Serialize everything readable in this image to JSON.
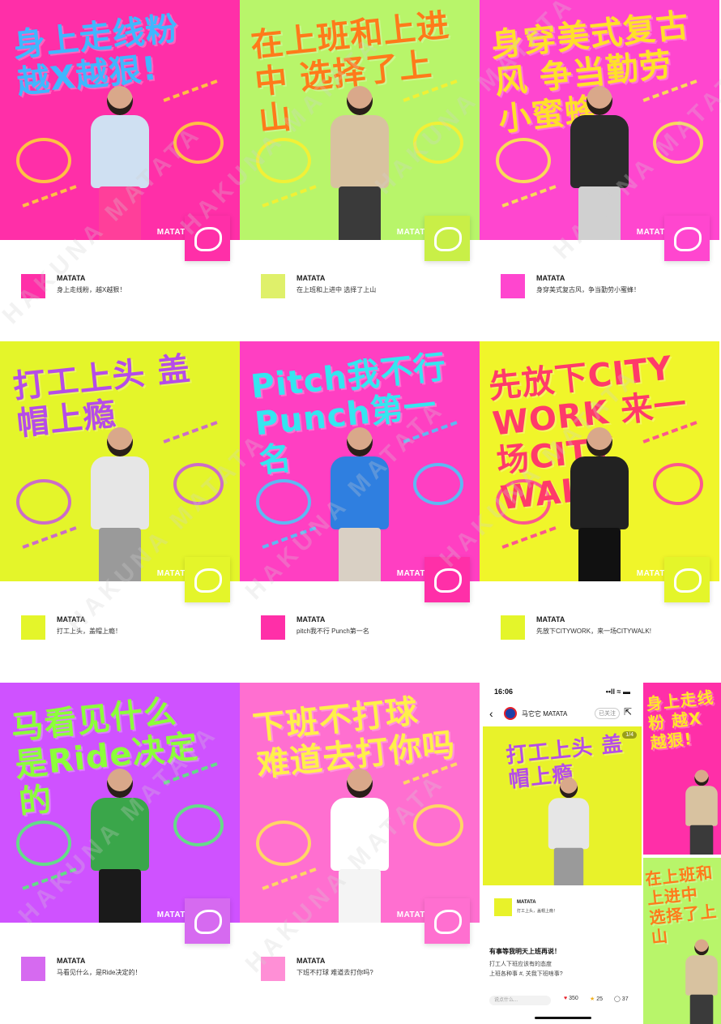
{
  "brand": "MATATA",
  "watermark": "HAKUNA MATATA",
  "posts": [
    {
      "headline": "身上走线粉 越X越狠!",
      "caption": "身上走线粉，越X越狠！",
      "bg": "#ff2fa8",
      "text_color": "#3fb7ff",
      "doodle_color": "#ffe52a",
      "sticker": "#ff2fa8",
      "avatar": "#ff2fa8",
      "top_color": "#cfe0f2",
      "bottom_color": "#ff3f9a"
    },
    {
      "headline": "在上班和上进中 选择了上山",
      "caption": "在上班和上进中 选择了上山",
      "bg": "#b8f56a",
      "text_color": "#ff7a1a",
      "doodle_color": "#ffef2a",
      "sticker": "#c9ef47",
      "avatar": "#dff06a",
      "top_color": "#d8c2a0",
      "bottom_color": "#3a3a3a"
    },
    {
      "headline": "身穿美式复古风 争当勤劳小蜜蜂",
      "caption": "身穿美式复古风，争当勤劳小蜜蜂！",
      "bg": "#ff46cf",
      "text_color": "#ffe02a",
      "doodle_color": "#f7ff3a",
      "sticker": "#ff46cf",
      "avatar": "#ff46cf",
      "top_color": "#2b2b2b",
      "bottom_color": "#d0d0d0"
    },
    {
      "headline": "打工上头 盖帽上瘾",
      "caption": "打工上头，盖帽上瘾！",
      "bg": "#e4f52a",
      "text_color": "#b54ce8",
      "doodle_color": "#c54af0",
      "sticker": "#e4f52a",
      "avatar": "#e4f52a",
      "top_color": "#e6e6e6",
      "bottom_color": "#9a9a9a"
    },
    {
      "headline": "Pitch我不行 Punch第一名",
      "caption": "pitch我不行 Punch第一名",
      "bg": "#ff3fc2",
      "text_color": "#34e6f0",
      "doodle_color": "#35d8ff",
      "sticker": "#ff2fa8",
      "avatar": "#ff2fa8",
      "top_color": "#2f7fe0",
      "bottom_color": "#d9d0c4"
    },
    {
      "headline": "先放下CITY WORK 来一场CITY WALK",
      "caption": "先放下CITYWORK，来一场CITYWALK!",
      "bg": "#f0f52a",
      "text_color": "#ff3a6a",
      "doodle_color": "#ff2fa8",
      "sticker": "#e4f52a",
      "avatar": "#e4f52a",
      "top_color": "#222222",
      "bottom_color": "#111111"
    },
    {
      "headline": "马看见什么 是Ride决定的",
      "caption": "马看见什么，是Ride决定的！",
      "bg": "#cf52ff",
      "text_color": "#8cff3a",
      "doodle_color": "#4aff6a",
      "sticker": "#d66af0",
      "avatar": "#d66af0",
      "top_color": "#3aa64a",
      "bottom_color": "#1a1a1a"
    },
    {
      "headline": "下班不打球 难道去打你吗",
      "caption": "下班不打球 难道去打你吗?",
      "bg": "#ff6fd0",
      "text_color": "#fff04a",
      "doodle_color": "#fff04a",
      "sticker": "#ff6fd0",
      "avatar": "#ff8fd6",
      "top_color": "#ffffff",
      "bottom_color": "#f4f4f4"
    }
  ],
  "phone": {
    "time": "16:06",
    "status_icons": "••ll ≈ ▬",
    "account": "马它它 MATATA",
    "follow": "已关注",
    "page_badge": "1/4",
    "post_headline": "打工上头 盖帽上瘾",
    "meta_name": "MATATA",
    "meta_caption": "打工上头，盖帽上瘾！",
    "title": "有事等我明天上班再说！",
    "body_line1": "打工人下班应该有的态度",
    "body_line2": "上班各种事 #, 关我下班啥事?",
    "comment_placeholder": "说点什么...",
    "likes": "350",
    "stars": "25",
    "comments": "37",
    "like_color": "#e8212b",
    "star_color": "#f2b01e"
  },
  "side_posts": [
    {
      "headline": "身上走线粉 越X越狠!",
      "bg": "#ff2fa8",
      "text_color": "#ffe52a"
    },
    {
      "headline": "在上班和上进中 选择了上山",
      "bg": "#b8f56a",
      "text_color": "#ff7a1a"
    }
  ]
}
